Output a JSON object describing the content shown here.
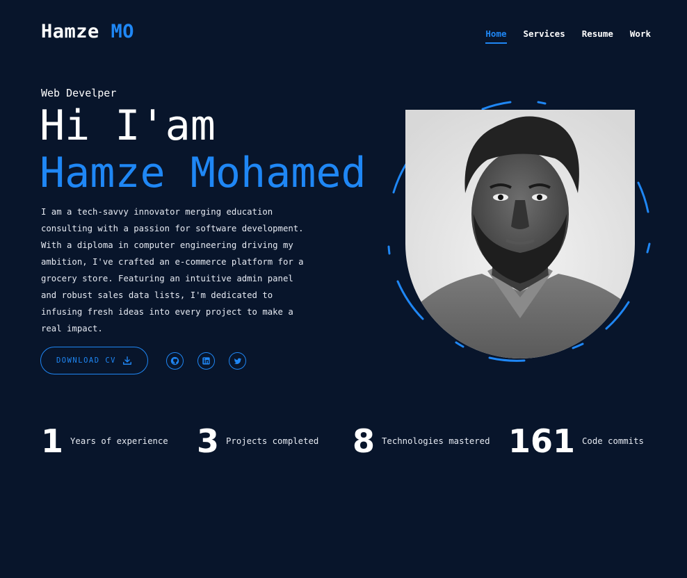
{
  "header": {
    "logo_main": "Hamze",
    "logo_accent": "MO",
    "nav": [
      "Home",
      "Services",
      "Resume",
      "Work"
    ]
  },
  "hero": {
    "subtitle": "Web Develper",
    "greeting": "Hi I'am",
    "name": "Hamze Mohamed",
    "bio": "I am a tech-savvy innovator merging education consulting with a passion for software development. With a diploma in computer engineering driving my ambition, I've crafted an e-commerce platform for a grocery store. Featuring an intuitive admin panel and robust sales data lists, I'm dedicated to infusing fresh ideas into every project to make a real impact.",
    "cv_button": "DOWNLOAD CV",
    "socials": [
      "github-icon",
      "linkedin-icon",
      "twitter-icon"
    ]
  },
  "stats": [
    {
      "value": "1",
      "label": "Years of experience"
    },
    {
      "value": "3",
      "label": "Projects completed"
    },
    {
      "value": "8",
      "label": "Technologies mastered"
    },
    {
      "value": "161",
      "label": "Code commits"
    }
  ],
  "colors": {
    "background": "#08152b",
    "accent": "#1f87f5",
    "text": "#ffffff"
  }
}
